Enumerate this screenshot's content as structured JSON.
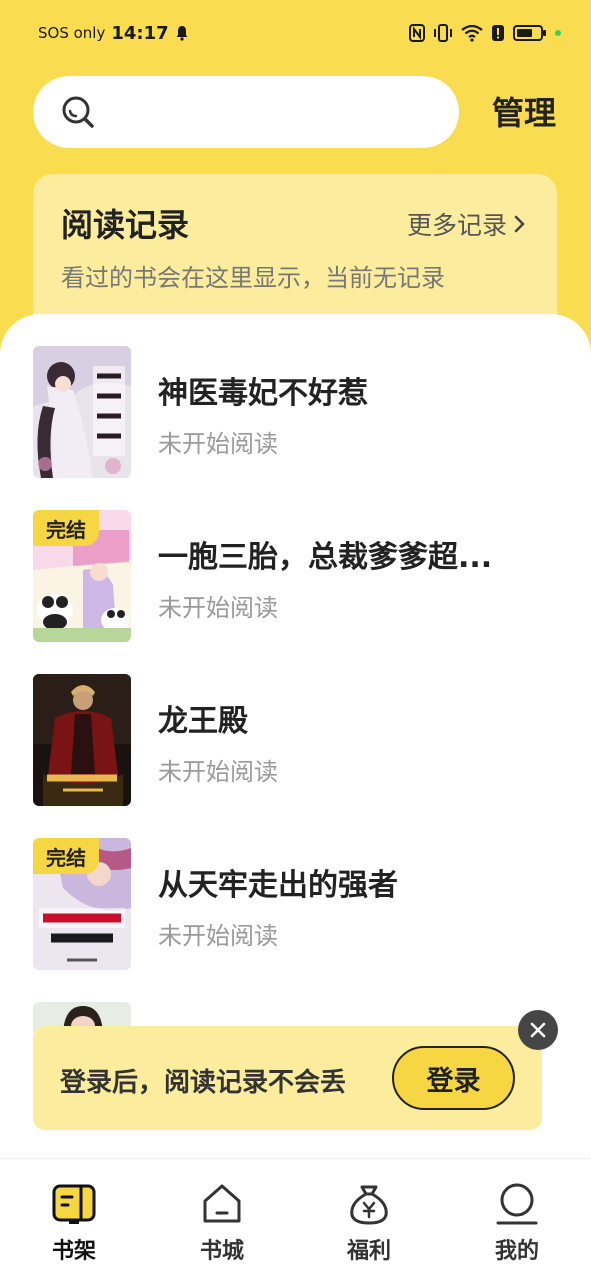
{
  "status_bar": {
    "carrier": "SOS only",
    "time": "14:17"
  },
  "search": {
    "placeholder": "",
    "manage_label": "管理"
  },
  "reading_record": {
    "title": "阅读记录",
    "more_label": "更多记录",
    "description": "看过的书会在这里显示，当前无记录"
  },
  "books": [
    {
      "title": "神医毒妃不好惹",
      "status": "未开始阅读",
      "badge": ""
    },
    {
      "title": "一胞三胎，总裁爹爹超...",
      "status": "未开始阅读",
      "badge": "完结"
    },
    {
      "title": "龙王殿",
      "status": "未开始阅读",
      "badge": ""
    },
    {
      "title": "从天牢走出的强者",
      "status": "未开始阅读",
      "badge": "完结"
    }
  ],
  "login_banner": {
    "text": "登录后，阅读记录不会丢",
    "button_label": "登录"
  },
  "bottom_nav": {
    "items": [
      {
        "label": "书架",
        "icon": "bookshelf-icon",
        "active": true
      },
      {
        "label": "书城",
        "icon": "bookstore-icon",
        "active": false
      },
      {
        "label": "福利",
        "icon": "money-bag-icon",
        "active": false
      },
      {
        "label": "我的",
        "icon": "profile-icon",
        "active": false
      }
    ]
  },
  "colors": {
    "accent_yellow": "#f9dc4f",
    "card_yellow": "#fbed9d",
    "badge_yellow": "#f6d642"
  }
}
